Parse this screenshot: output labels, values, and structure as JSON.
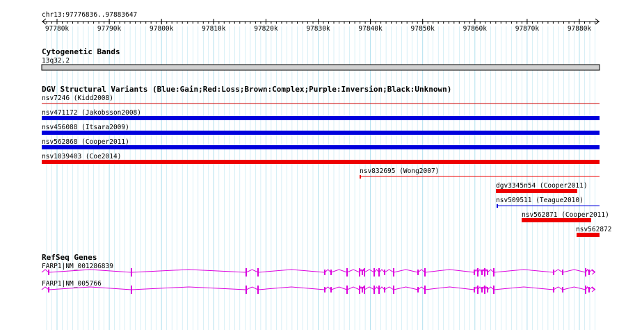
{
  "ruler": {
    "location": "chr13:97776836..97883647",
    "ticks": [
      "97780k",
      "97790k",
      "97800k",
      "97810k",
      "97820k",
      "97830k",
      "97840k",
      "97850k",
      "97860k",
      "97870k",
      "97880k"
    ]
  },
  "cytoband_track": {
    "title": "Cytogenetic Bands",
    "band_label": "13q32.2"
  },
  "dgv_track": {
    "title": "DGV Structural Variants (Blue:Gain;Red:Loss;Brown:Complex;Purple:Inversion;Black:Unknown)",
    "features": [
      {
        "label": "nsv7246 (Kidd2008)",
        "color": "#cc0000",
        "style": "line"
      },
      {
        "label": "nsv471172 (Jakobsson2008)",
        "color": "#0000dd",
        "style": "bar"
      },
      {
        "label": "nsv456088 (Itsara2009)",
        "color": "#0000dd",
        "style": "bar"
      },
      {
        "label": "nsv562868 (Cooper2011)",
        "color": "#0000dd",
        "style": "bar"
      },
      {
        "label": "nsv1039403 (Coe2014)",
        "color": "#ee0000",
        "style": "bar"
      },
      {
        "label": "nsv832695 (Wong2007)",
        "color": "#ee0000",
        "style": "line"
      },
      {
        "label": "dgv3345n54 (Cooper2011)",
        "color": "#ee0000",
        "style": "bar"
      },
      {
        "label": "nsv509511 (Teague2010)",
        "color": "#0000dd",
        "style": "line"
      },
      {
        "label": "nsv562871 (Cooper2011)",
        "color": "#ee0000",
        "style": "bar"
      },
      {
        "label": "nsv562872",
        "color": "#ee0000",
        "style": "bar"
      }
    ]
  },
  "refseq_track": {
    "title": "RefSeq Genes",
    "genes": [
      {
        "label": "FARP1|NM_001286839",
        "color": "#dd00dd"
      },
      {
        "label": "FARP1|NM_005766",
        "color": "#dd00dd"
      }
    ]
  },
  "colors": {
    "grid": "#b0e0ee",
    "ruler": "#000000",
    "cytoband_fill": "#d0d0d0"
  }
}
